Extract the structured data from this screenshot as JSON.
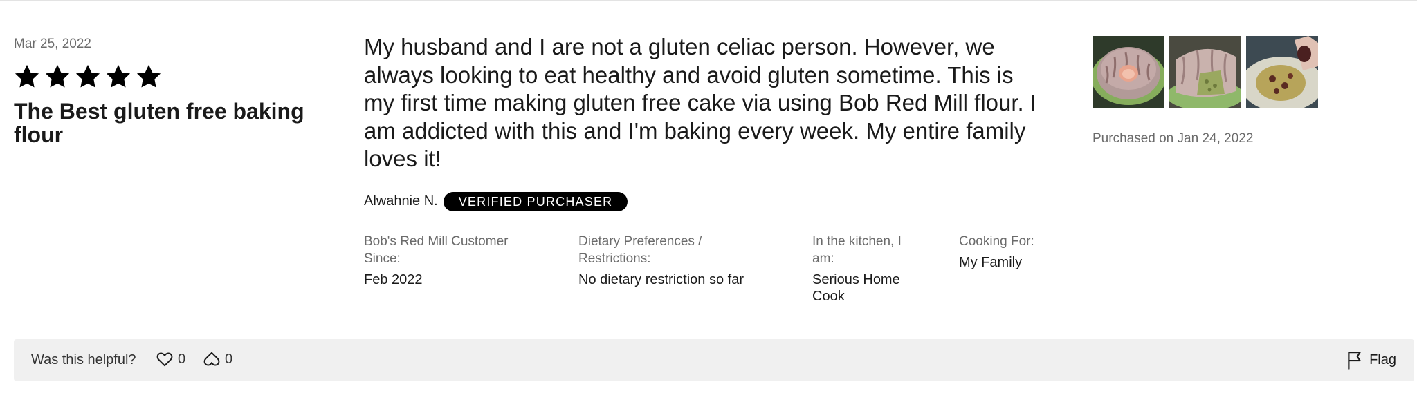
{
  "review": {
    "date": "Mar 25, 2022",
    "rating": 5,
    "rating_max": 5,
    "title": "The Best gluten free baking flour",
    "body": "My husband and I are not a gluten celiac person. However, we always looking to eat healthy and avoid gluten sometime. This is my first time making gluten free cake via using Bob Red Mill flour. I am addicted with this and I'm baking every week. My entire family loves it!",
    "author": "Alwahnie N.",
    "badge": "VERIFIED PURCHASER",
    "details": [
      {
        "label": "Bob's Red Mill Customer Since:",
        "value": "Feb 2022"
      },
      {
        "label": "Dietary Preferences / Restrictions:",
        "value": "No dietary restriction so far"
      },
      {
        "label": "In the kitchen, I am:",
        "value": "Serious Home Cook"
      },
      {
        "label": "Cooking For:",
        "value": "My Family"
      }
    ],
    "purchased": "Purchased on Jan 24, 2022",
    "photos": [
      "bundt-cake-photo",
      "sliced-cake-photo",
      "cake-closeup-photo"
    ]
  },
  "feedback": {
    "helpful_label": "Was this helpful?",
    "upvotes": "0",
    "downvotes": "0",
    "flag_label": "Flag"
  },
  "colors": {
    "text": "#1a1a1a",
    "muted": "#6b6b6b",
    "badge_bg": "#000000",
    "bar_bg": "#f0f0f0"
  }
}
